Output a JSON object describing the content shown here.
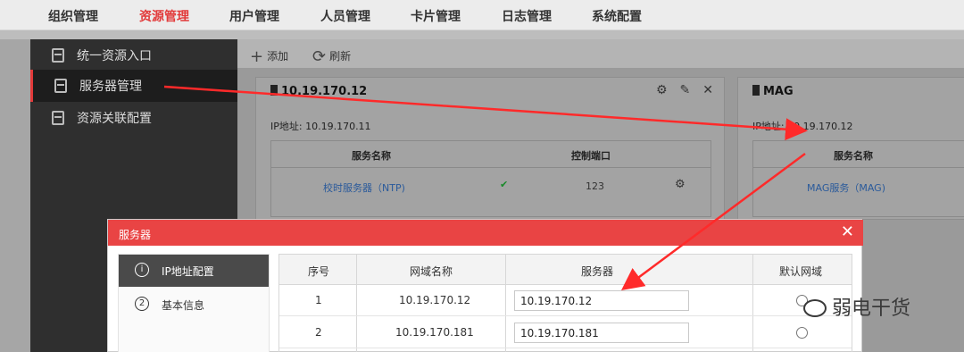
{
  "topnav": {
    "items": [
      {
        "label": "组织管理"
      },
      {
        "label": "资源管理",
        "active": true
      },
      {
        "label": "用户管理"
      },
      {
        "label": "人员管理"
      },
      {
        "label": "卡片管理"
      },
      {
        "label": "日志管理"
      },
      {
        "label": "系统配置"
      }
    ]
  },
  "sidebar": {
    "items": [
      {
        "label": "统一资源入口",
        "icon": "resource-icon"
      },
      {
        "label": "服务器管理",
        "icon": "server-icon",
        "active": true
      },
      {
        "label": "资源关联配置",
        "icon": "link-config-icon"
      }
    ]
  },
  "toolbar": {
    "add_label": "添加",
    "refresh_label": "刷新"
  },
  "cards": [
    {
      "title": "10.19.170.12",
      "ip_label": "IP地址: 10.19.170.11",
      "col_service": "服务名称",
      "col_port": "控制端口",
      "row_service": "校时服务器（NTP)",
      "row_port": "123"
    },
    {
      "title": "MAG",
      "ip_label": "IP地址: 10.19.170.12",
      "col_service": "服务名称",
      "row_service": "MAG服务（MAG)"
    }
  ],
  "modal": {
    "title": "服务器",
    "tabs": [
      {
        "num": "①",
        "label": "IP地址配置",
        "active": true
      },
      {
        "num": "②",
        "label": "基本信息"
      }
    ],
    "headers": {
      "index": "序号",
      "domain": "网域名称",
      "server_ip": "服务器",
      "default": "默认网域"
    },
    "rows": [
      {
        "index": "1",
        "domain": "10.19.170.12",
        "ip": "10.19.170.12"
      },
      {
        "index": "2",
        "domain": "10.19.170.181",
        "ip": "10.19.170.181"
      }
    ]
  },
  "watermark": "弱电干货",
  "colors": {
    "accent": "#e94444",
    "nav_active": "#e23a3a",
    "arrow": "#ff2a2a"
  }
}
